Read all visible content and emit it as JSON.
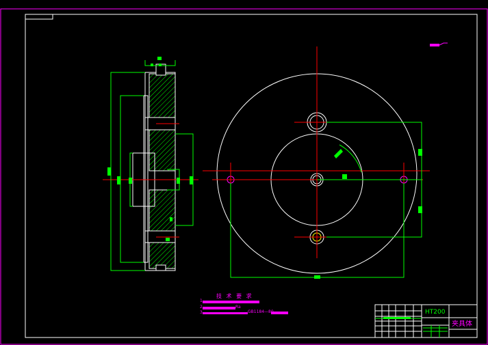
{
  "colors": {
    "background": "#000000",
    "frame": "#ffffff",
    "sheet_border": "#ff00ff",
    "dimension": "#00ff00",
    "centerline": "#ff0000",
    "text": "#ff00ff",
    "hatch": "#00ff00"
  },
  "technical_notes": {
    "title": "技 术 要 求",
    "items": [
      {
        "number": "1",
        "tail": ""
      },
      {
        "number": "2",
        "tail": "Ra"
      },
      {
        "number": "3",
        "tail": "GB1184—80"
      }
    ]
  },
  "title_block": {
    "material": "HT200",
    "part_name": "夹具体"
  }
}
